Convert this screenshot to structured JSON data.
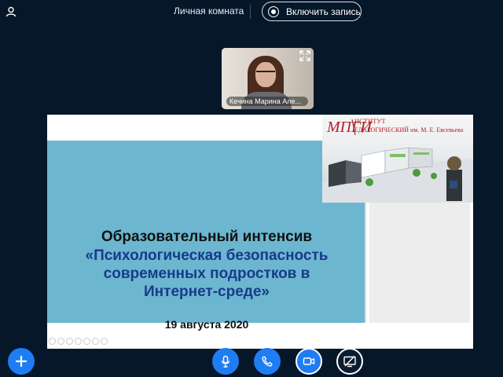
{
  "topbar": {
    "room_name": "Личная комната",
    "record_label": "Включить запись",
    "icons": [
      "user-icon",
      "record-icon"
    ]
  },
  "webcam": {
    "participant_name": "Кечина Марина Але...",
    "icons": [
      "fullscreen-icon"
    ]
  },
  "slide": {
    "banner": {
      "logo_letters": "МПГИ",
      "institute_line1": "НСТИТУТ",
      "institute_line2": "ЕДАГОГИЧЕСКИЙ им. М. Е. Евсевьева"
    },
    "title": "Образовательный интенсив",
    "subtitle_lines": [
      "«Психологическая безопасность",
      "современных подростков в",
      "Интернет-среде»"
    ],
    "date": "19 августа 2020",
    "colors": {
      "blue_panel": "#6cb6cf",
      "subtitle": "#183a8c"
    }
  },
  "controls": {
    "buttons": [
      "add-icon",
      "microphone-icon",
      "phone-icon",
      "camera-icon",
      "screen-share-off-icon"
    ],
    "accent": "#1f7df3"
  }
}
